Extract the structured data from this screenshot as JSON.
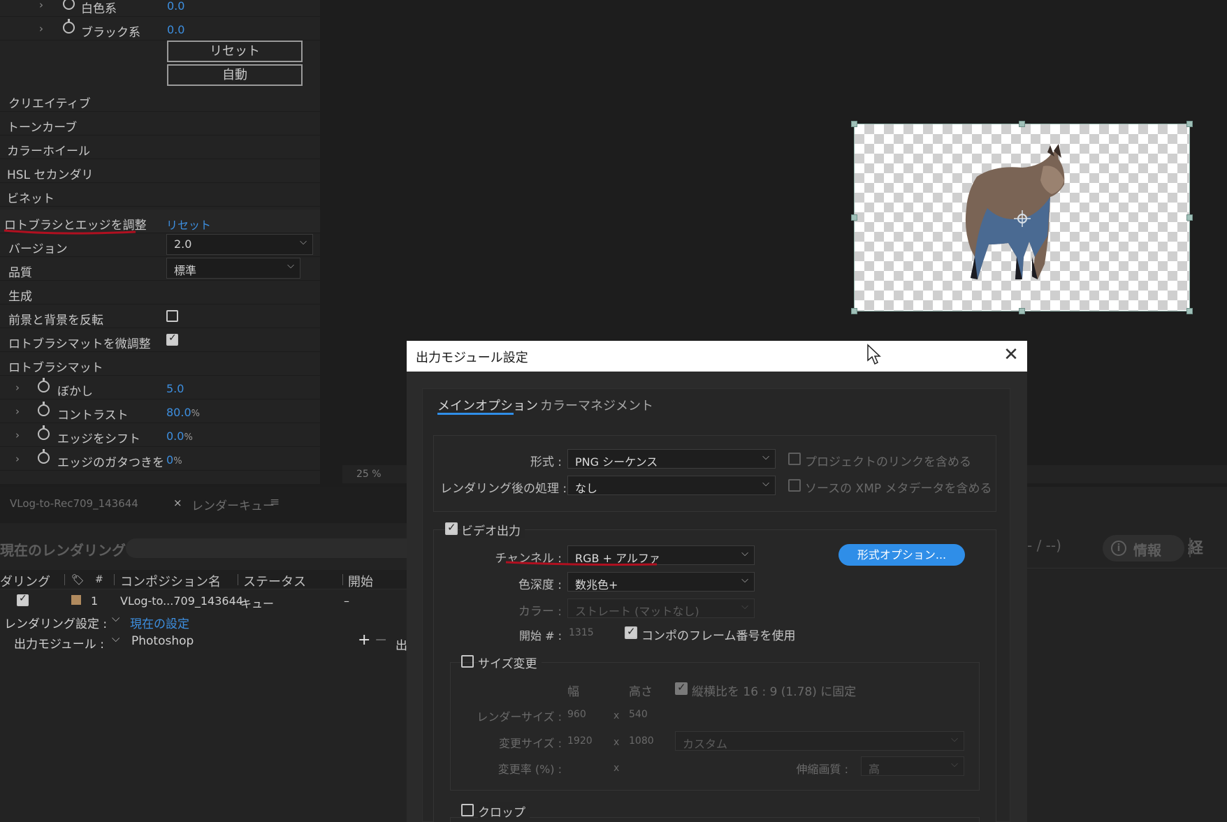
{
  "effect_controls": {
    "white_row": {
      "label": "白色系",
      "value": "0.0"
    },
    "black_row": {
      "label": "ブラック系",
      "value": "0.0"
    },
    "reset_button": "リセット",
    "auto_button": "自動",
    "sections": [
      "クリエイティブ",
      "トーンカーブ",
      "カラーホイール",
      "HSL セカンダリ",
      "ビネット"
    ],
    "roto_title": "ロトブラシとエッジを調整",
    "roto_reset": "リセット",
    "version": {
      "label": "バージョン",
      "value": "2.0"
    },
    "quality": {
      "label": "品質",
      "value": "標準"
    },
    "generate": "生成",
    "invert": {
      "label": "前景と背景を反転",
      "checked": false
    },
    "refine": {
      "label": "ロトブラシマットを微調整",
      "checked": true
    },
    "matte_section": "ロトブラシマット",
    "feather": {
      "label": "ぼかし",
      "value": "5.0"
    },
    "contrast": {
      "label": "コントラスト",
      "value": "80.0",
      "unit": "%"
    },
    "shift_edge": {
      "label": "エッジをシフト",
      "value": "0.0",
      "unit": "%"
    },
    "chatter": {
      "label": "エッジのガタつきを",
      "value": "0",
      "unit": "%"
    }
  },
  "viewer": {
    "zoom": "25 %"
  },
  "render_queue": {
    "comp_tab": "VLog-to-Rec709_143644",
    "close_glyph": "×",
    "queue_tab": "レンダーキュー",
    "menu_glyph": "≡",
    "current_rendering": "現在のレンダリング",
    "columns": [
      "ダリング",
      "#",
      "コンポジション名",
      "ステータス",
      "開始"
    ],
    "row": {
      "num": "1",
      "comp": "VLog-to...709_143644",
      "status": "キュー",
      "start": "–"
    },
    "render_settings_label": "レンダリング設定 :",
    "render_settings_value": "現在の設定",
    "output_module_label": "出力モジュール :",
    "output_module_value": "Photoshop",
    "output_prefix": "出",
    "elapsed_partial": "- / --)",
    "info_button": "情報",
    "elapsed_label": "経"
  },
  "dialog": {
    "title": "出力モジュール設定",
    "tabs": [
      "メインオプション",
      "カラーマネジメント"
    ],
    "format_label": "形式 :",
    "format_value": "PNG シーケンス",
    "post_render_label": "レンダリング後の処理 :",
    "post_render_value": "なし",
    "include_project_link": "プロジェクトのリンクを含める",
    "include_xmp": "ソースの XMP メタデータを含める",
    "video_output": "ビデオ出力",
    "channels_label": "チャンネル :",
    "channels_value": "RGB + アルファ",
    "format_options_button": "形式オプション...",
    "depth_label": "色深度 :",
    "depth_value": "数兆色+",
    "color_label": "カラー :",
    "color_value": "ストレート (マットなし)",
    "start_label": "開始 # :",
    "start_value": "1315",
    "use_comp_frame": "コンポのフレーム番号を使用",
    "resize": "サイズ変更",
    "width_label": "幅",
    "height_label": "高さ",
    "lock_aspect": "縦横比を 16 : 9 (1.78) に固定",
    "render_size_label": "レンダーサイズ :",
    "render_w": "960",
    "render_h": "540",
    "resize_to_label": "変更サイズ :",
    "resize_w": "1920",
    "resize_h": "1080",
    "resize_preset": "カスタム",
    "resize_pct_label": "変更率 (%) :",
    "x": "x",
    "resize_quality_label": "伸縮画質 :",
    "resize_quality_value": "高",
    "crop": "クロップ",
    "close_glyph": "✕"
  },
  "colors": {
    "accent": "#2f8ee8",
    "value_blue": "#3d8fe0",
    "annotation_red": "#b01020"
  }
}
